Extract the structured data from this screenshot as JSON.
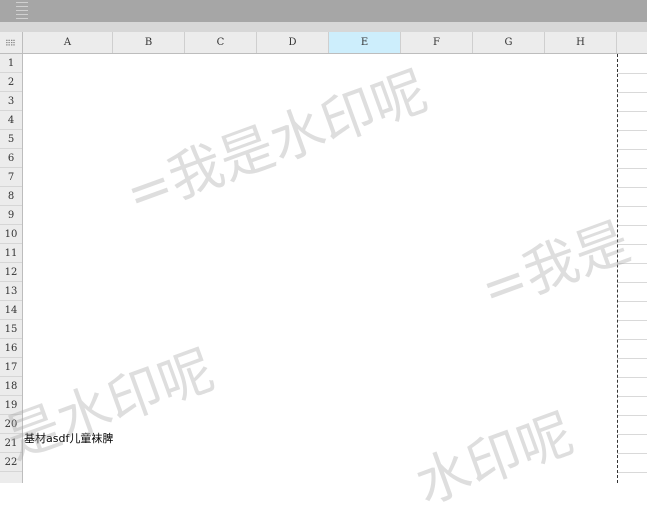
{
  "spreadsheet": {
    "columns": [
      "A",
      "B",
      "C",
      "D",
      "E",
      "F",
      "G",
      "H"
    ],
    "selected_column": "E",
    "rows": [
      "1",
      "2",
      "3",
      "4",
      "5",
      "6",
      "7",
      "8",
      "9",
      "10",
      "11",
      "12",
      "13",
      "14",
      "15",
      "16",
      "17",
      "18",
      "19",
      "20",
      "21",
      "22"
    ],
    "cell_A20": "基材asdf儿童袜脾"
  },
  "watermarks": {
    "w1": "=我是水印呢",
    "w2": "=我是",
    "w3": "是水印呢",
    "w4": "水印呢"
  },
  "colors": {
    "selected_header": "#cdeefc",
    "header_bg": "#ececec",
    "toolbar_bg": "#a6a6a6"
  }
}
